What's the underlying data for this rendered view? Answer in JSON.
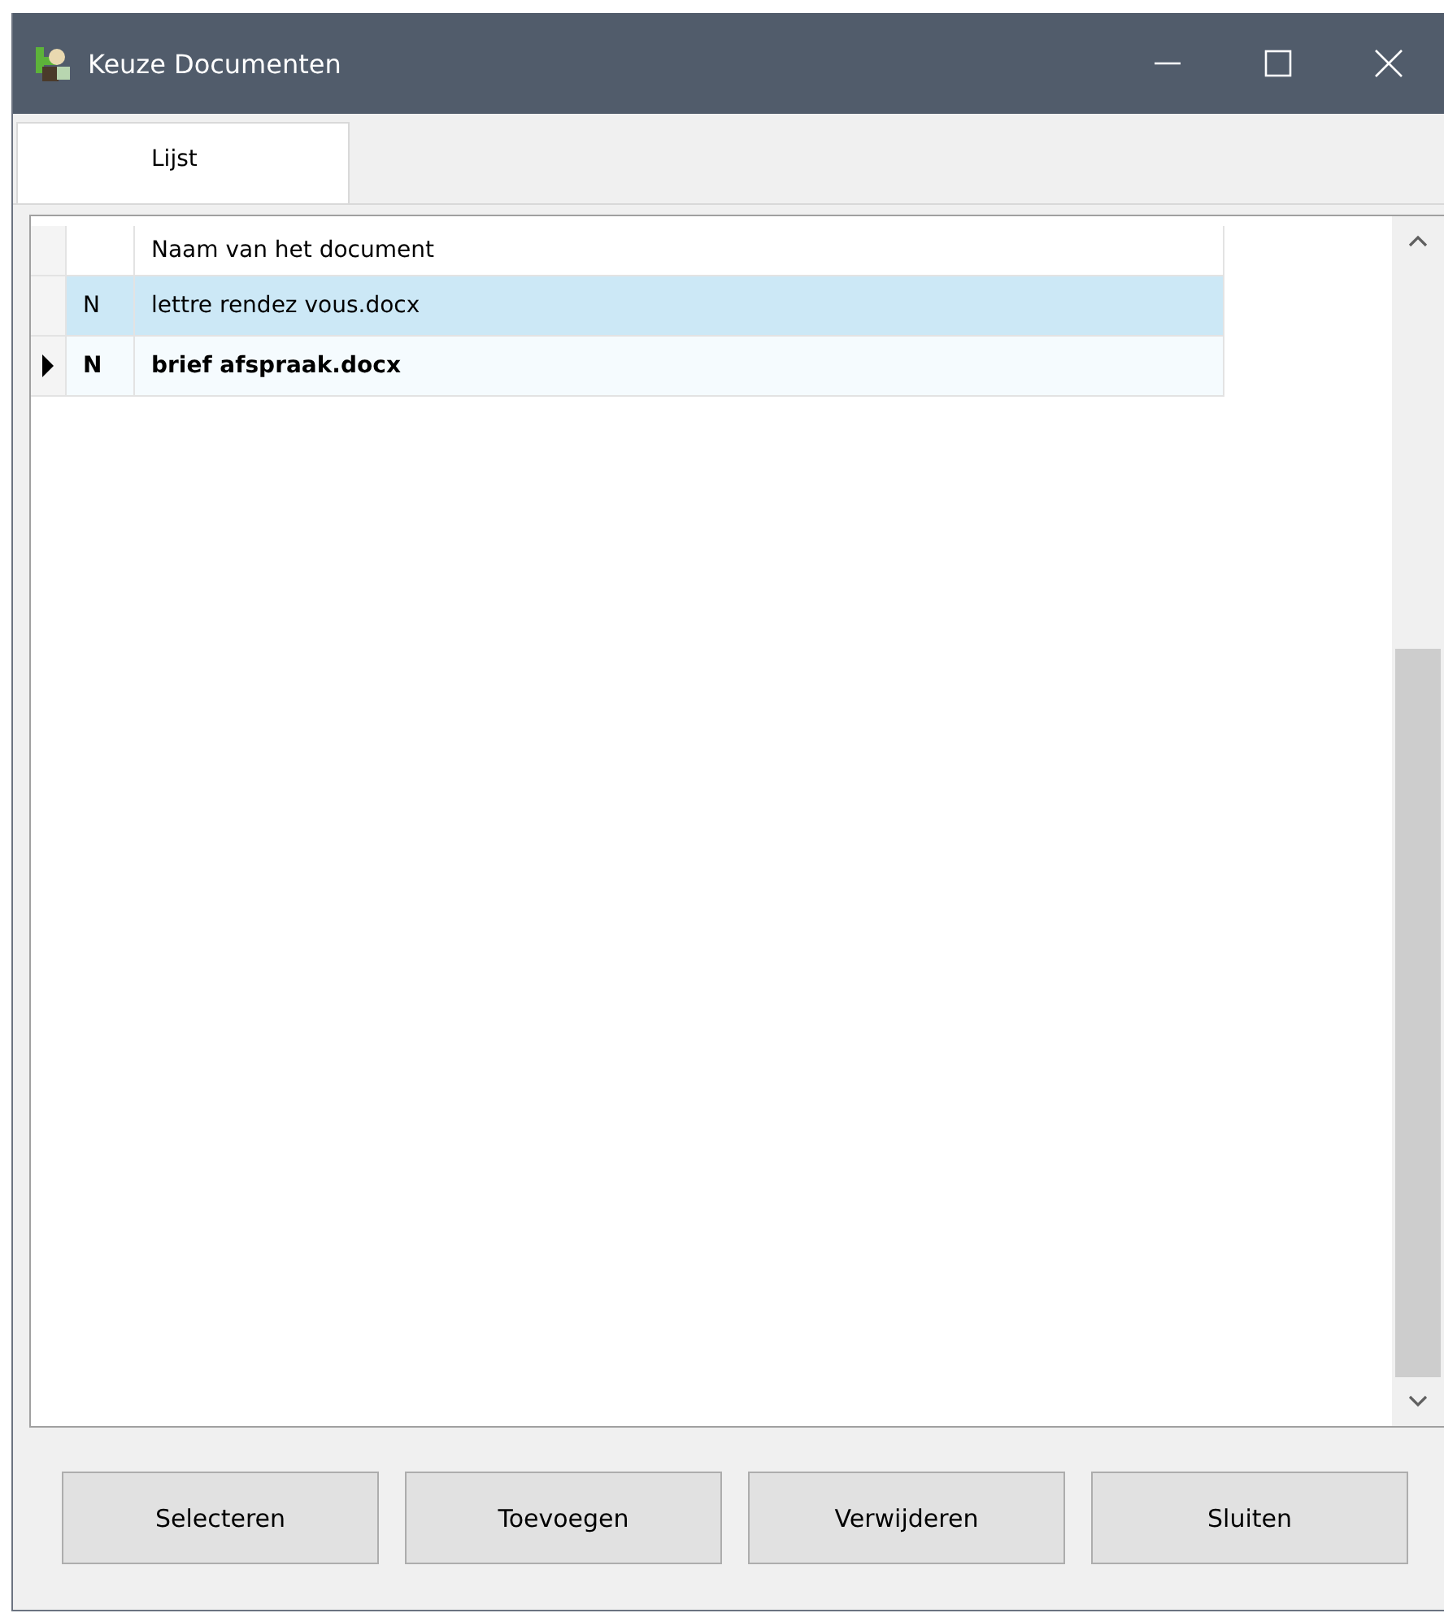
{
  "window": {
    "title": "Keuze Documenten"
  },
  "tabs": [
    {
      "label": "Lijst",
      "selected": true
    }
  ],
  "table": {
    "columns": [
      "Naam van het document"
    ],
    "rows": [
      {
        "flag": "N",
        "name": "lettre rendez vous.docx",
        "selected": true,
        "current": false
      },
      {
        "flag": "N",
        "name": "brief afspraak.docx",
        "selected": false,
        "current": true
      }
    ]
  },
  "buttons": [
    "Selecteren",
    "Toevoegen",
    "Verwijderen",
    "Sluiten"
  ]
}
